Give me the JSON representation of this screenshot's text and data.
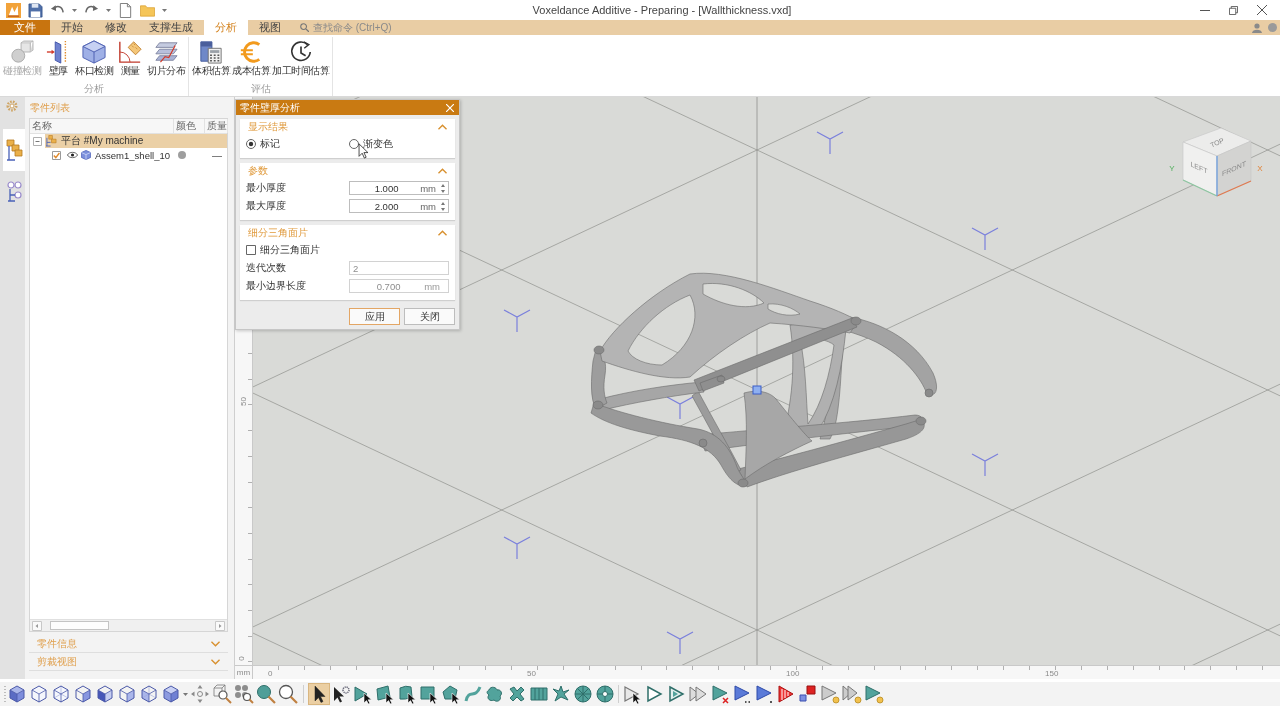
{
  "title_bar": {
    "title": "Voxeldance Additive - Preparing - [Wallthickness.vxd]"
  },
  "ribbon": {
    "tabs": [
      {
        "label": "文件",
        "kind": "menu",
        "selected": false
      },
      {
        "label": "开始",
        "kind": "tab",
        "selected": false
      },
      {
        "label": "修改",
        "kind": "tab",
        "selected": false
      },
      {
        "label": "支撑生成",
        "kind": "tab",
        "selected": false
      },
      {
        "label": "分析",
        "kind": "tab",
        "selected": true
      },
      {
        "label": "视图",
        "kind": "tab",
        "selected": false
      }
    ],
    "search": {
      "placeholder": "查找命令 (Ctrl+Q)"
    },
    "groups": [
      {
        "label": "分析",
        "commands": [
          {
            "label": "碰撞检测",
            "disabled": true
          },
          {
            "label": "壁厚",
            "disabled": false
          },
          {
            "label": "杯口检测",
            "disabled": false
          },
          {
            "label": "测量",
            "disabled": false
          },
          {
            "label": "切片分布",
            "disabled": false
          }
        ]
      },
      {
        "label": "评估",
        "commands": [
          {
            "label": "体积估算",
            "disabled": false
          },
          {
            "label": "成本估算",
            "disabled": false
          },
          {
            "label": "加工时间估算",
            "disabled": false
          }
        ]
      }
    ]
  },
  "side_tabs": [
    {
      "selected": true
    },
    {
      "selected": false
    }
  ],
  "parts_panel": {
    "title": "零件列表",
    "columns": [
      "名称",
      "颜色",
      "质量"
    ],
    "tree": [
      {
        "name": "平台 #My machine",
        "expanded": true,
        "selected": true,
        "children": [
          {
            "name": "Assem1_shell_10",
            "checked": true,
            "visible": true,
            "color": "#9e9e9e",
            "quality": "—",
            "selected": false
          }
        ]
      }
    ],
    "sections": [
      {
        "title": "零件信息",
        "expanded": false
      },
      {
        "title": "剪裁视图",
        "expanded": false
      }
    ]
  },
  "dialog": {
    "title": "零件壁厚分析",
    "sections": [
      {
        "title": "显示结果",
        "expanded": true,
        "rows": [
          {
            "kind": "radios",
            "options": [
              {
                "label": "标记",
                "selected": true
              },
              {
                "label": "渐变色",
                "selected": false
              }
            ]
          }
        ]
      },
      {
        "title": "参数",
        "expanded": true,
        "rows": [
          {
            "kind": "spin",
            "label": "最小厚度",
            "value": "1.000",
            "unit": "mm",
            "disabled": false
          },
          {
            "kind": "spin",
            "label": "最大厚度",
            "value": "2.000",
            "unit": "mm",
            "disabled": false
          }
        ]
      },
      {
        "title": "细分三角面片",
        "expanded": true,
        "rows": [
          {
            "kind": "checkbox",
            "label": "细分三角面片",
            "checked": false
          },
          {
            "kind": "field",
            "label": "迭代次数",
            "value": "2",
            "disabled": true
          },
          {
            "kind": "field",
            "label": "最小边界长度",
            "value": "0.700",
            "unit": "mm",
            "disabled": true
          }
        ]
      }
    ],
    "buttons": [
      {
        "label": "应用",
        "focused": true
      },
      {
        "label": "关闭",
        "focused": false
      }
    ]
  },
  "viewport": {
    "vertical_ruler": [
      "50",
      "0"
    ],
    "ruler_unit": "mm",
    "horizontal_ruler": [
      "0",
      "50",
      "100",
      "150"
    ],
    "view_cube": {
      "faces": [
        "TOP",
        "LEFT",
        "FRONT"
      ],
      "axes": [
        "Y",
        "X"
      ]
    }
  },
  "bottom_toolbar": {
    "select_modes": [
      {
        "selected": true
      },
      {
        "selected": false
      },
      {
        "selected": false
      },
      {
        "selected": false
      },
      {
        "selected": false
      },
      {
        "selected": false
      },
      {
        "selected": false
      },
      {
        "selected": false
      },
      {
        "selected": false
      },
      {
        "selected": false
      },
      {
        "selected": false
      },
      {
        "selected": false
      },
      {
        "selected": false
      },
      {
        "selected": false
      }
    ]
  }
}
